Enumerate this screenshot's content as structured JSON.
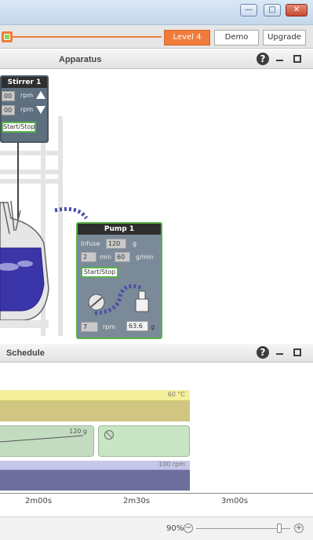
{
  "window": {
    "controls": {
      "minimize": "—",
      "maximize": "□",
      "close": "✕"
    }
  },
  "topbar": {
    "level_label": "Level 4",
    "demo_label": "Demo",
    "upgrade_label": "Upgrade"
  },
  "apparatus": {
    "title": "Apparatus",
    "help": "?"
  },
  "stirrer": {
    "title": "Stirrer 1",
    "speed_value": "00",
    "speed_set": "00",
    "unit": "rpm",
    "start_stop": "Start/Stop"
  },
  "pump": {
    "title": "Pump 1",
    "mode": "Infuse",
    "amount": "120",
    "amount_unit": "g",
    "duration": "2",
    "duration_unit": "min",
    "rate": "60",
    "rate_unit": "g/min",
    "start_stop": "Start/Stop",
    "speed": "7",
    "speed_unit": "rpm",
    "reading": "63.6",
    "reading_unit": "g"
  },
  "schedule": {
    "title": "Schedule",
    "help": "?",
    "temp_label": "60 °C",
    "pump_label": "120 g",
    "stir_label": "100 rpm",
    "ticks": [
      "2m00s",
      "2m30s",
      "3m00s"
    ],
    "zoom": "90%",
    "zoom_out": "−",
    "zoom_in": "+"
  },
  "colors": {
    "accent": "#f07c3c",
    "device_frame": "#5e6f80",
    "start_green": "#57b24a"
  }
}
